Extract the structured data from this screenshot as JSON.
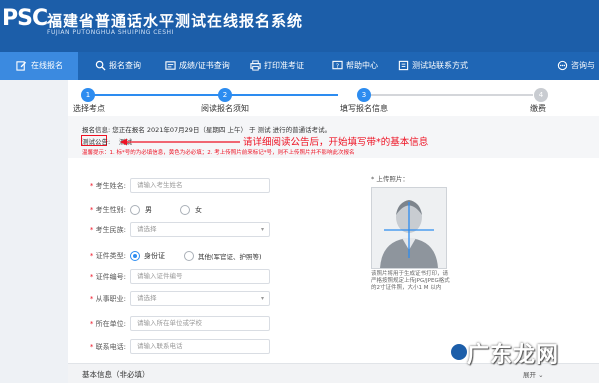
{
  "header": {
    "logo": "PSC",
    "title": "福建省普通话水平测试在线报名系统",
    "subtitle": "FUJIAN PUTONGHUA SHUIPING CESHI"
  },
  "nav": [
    {
      "label": "在线报名",
      "icon": "edit-icon"
    },
    {
      "label": "报名查询",
      "icon": "search-icon"
    },
    {
      "label": "成绩/证书查询",
      "icon": "certificate-icon"
    },
    {
      "label": "打印准考证",
      "icon": "printer-icon"
    },
    {
      "label": "帮助中心",
      "icon": "help-icon"
    },
    {
      "label": "测试站联系方式",
      "icon": "contact-icon"
    },
    {
      "label": "咨询与",
      "icon": "chat-icon"
    }
  ],
  "steps": [
    {
      "num": "1",
      "label": "选择考点"
    },
    {
      "num": "2",
      "label": "阅读报名须知"
    },
    {
      "num": "3",
      "label": "填写报名信息"
    },
    {
      "num": "4",
      "label": "缴费"
    }
  ],
  "notice": {
    "info": "报名信息: 您正在报名 2021年07月29日（星期四 上午） 于 测试 进行的普通话考试。",
    "ann_label": "测试公告:",
    "ann_after": "测试",
    "red_note": "请详细阅读公告后，开始填写带*的基本信息",
    "tip": "温馨提示：1. 标*号的为必填信息，黄色为必必填；2. 考上传照片前来标记*号，则不上传照片并不影响此次报名"
  },
  "form": {
    "name": {
      "label": "考生姓名:",
      "placeholder": "请输入考生姓名"
    },
    "gender": {
      "label": "考生性别:",
      "options": [
        "男",
        "女"
      ]
    },
    "ethnicity": {
      "label": "考生民族:",
      "placeholder": "请选择"
    },
    "id_type": {
      "label": "证件类型:",
      "options": [
        "身份证",
        "其他(军官证、护照等)"
      ],
      "selected": "身份证"
    },
    "id_no": {
      "label": "证件编号:",
      "placeholder": "请输入证件编号"
    },
    "occupation": {
      "label": "从事职业:",
      "placeholder": "请选择"
    },
    "unit": {
      "label": "所在单位:",
      "placeholder": "请输入所在单位或学校"
    },
    "phone": {
      "label": "联系电话:",
      "placeholder": "请输入联系电话"
    }
  },
  "photo": {
    "label": "* 上传照片：",
    "note": "该照片将用于生成证书打印，请严格按照规定上传JPG/JPEG格式的2寸证件照，大小1 M 以内"
  },
  "basic": {
    "title": "基本信息（非必填）",
    "toggle": "展开"
  },
  "watermark": "广东龙网",
  "colors": {
    "header": "#1c5ea9",
    "nav": "#1f66b5",
    "nav_active": "#3b8ae0",
    "accent": "#2d8cf0",
    "warning": "#e11122"
  }
}
